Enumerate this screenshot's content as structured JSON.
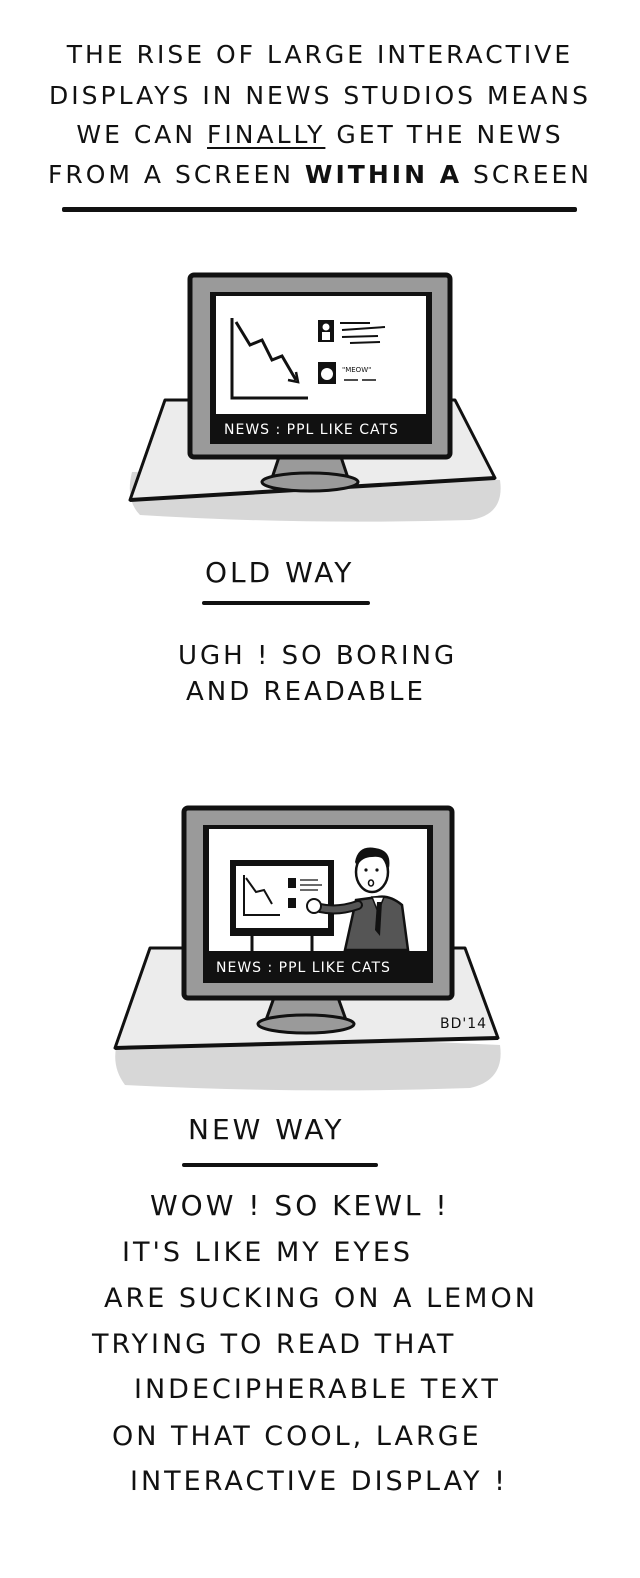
{
  "title": {
    "line1": "THE RISE OF LARGE INTERACTIVE",
    "line2": "DISPLAYS IN NEWS STUDIOS MEANS",
    "line3_pre": "WE CAN ",
    "line3_underlined": "FINALLY",
    "line3_post": " GET THE NEWS",
    "line4_pre": "FROM A SCREEN ",
    "line4_bold": "WITHIN A",
    "line4_post": " SCREEN"
  },
  "old_way": {
    "ticker": "NEWS : PPL LIKE CATS",
    "meow": "\"MEOW\"",
    "heading": "OLD WAY",
    "caption": [
      "UGH ! SO BORING",
      "AND READABLE"
    ]
  },
  "new_way": {
    "ticker": "NEWS : PPL LIKE CATS",
    "heading": "NEW WAY",
    "caption": [
      "WOW ! SO KEWL !",
      "IT'S LIKE MY EYES",
      "ARE SUCKING ON A LEMON",
      "TRYING TO READ THAT",
      "INDECIPHERABLE TEXT",
      "ON THAT COOL, LARGE",
      "INTERACTIVE DISPLAY !"
    ]
  },
  "signature": "BD'14",
  "colors": {
    "ink": "#111111",
    "bezel": "#9a9a9a",
    "shadow": "#d7d7d7",
    "desk": "#ececec",
    "screen": "#ffffff"
  }
}
